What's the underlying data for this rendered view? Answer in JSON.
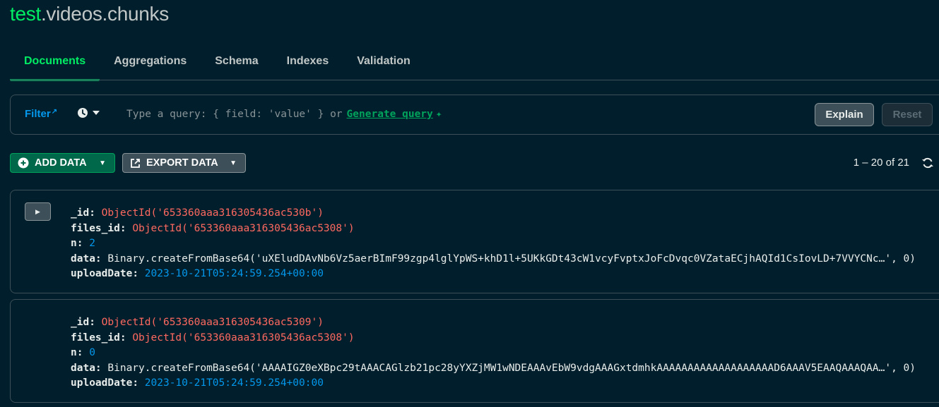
{
  "collection": {
    "db": "test",
    "rest": ".videos.chunks"
  },
  "tabs": [
    "Documents",
    "Aggregations",
    "Schema",
    "Indexes",
    "Validation"
  ],
  "query_bar": {
    "filter_label": "Filter",
    "placeholder": "Type a query: { field: 'value' } or",
    "generate_label": "Generate query",
    "explain_label": "Explain",
    "reset_label": "Reset"
  },
  "toolbar": {
    "add_label": "ADD DATA",
    "export_label": "EXPORT DATA",
    "pagination": "1 – 20 of 21"
  },
  "documents": [
    {
      "fields": [
        {
          "key": "_id",
          "value": "ObjectId('653360aaa316305436ac530b')",
          "kind": "oid"
        },
        {
          "key": "files_id",
          "value": "ObjectId('653360aaa316305436ac5308')",
          "kind": "oid"
        },
        {
          "key": "n",
          "value": "2",
          "kind": "num"
        },
        {
          "key": "data",
          "value": "Binary.createFromBase64('uXEludDAvNb6Vz5aerBImF99zgp4lglYpWS+khD1l+5UKkGDt43cW1vcyFvptxJoFcDvqc0VZataECjhAQId1CsIovLD+7VVYCNc…', 0)",
          "kind": "bin"
        },
        {
          "key": "uploadDate",
          "value": "2023-10-21T05:24:59.254+00:00",
          "kind": "date"
        }
      ]
    },
    {
      "fields": [
        {
          "key": "_id",
          "value": "ObjectId('653360aaa316305436ac5309')",
          "kind": "oid"
        },
        {
          "key": "files_id",
          "value": "ObjectId('653360aaa316305436ac5308')",
          "kind": "oid"
        },
        {
          "key": "n",
          "value": "0",
          "kind": "num"
        },
        {
          "key": "data",
          "value": "Binary.createFromBase64('AAAAIGZ0eXBpc29tAAACAGlzb21pc28yYXZjMW1wNDEAAAvEbW9vdgAAAGxtdmhkAAAAAAAAAAAAAAAAAAAD6AAAV5EAAQAAAQAA…', 0)",
          "kind": "bin"
        },
        {
          "key": "uploadDate",
          "value": "2023-10-21T05:24:59.254+00:00",
          "kind": "date"
        }
      ]
    }
  ],
  "colors": {
    "background": "#001e2b",
    "accent_green": "#00ed64",
    "link_blue": "#0498ec",
    "objectid_red": "#ff6960"
  },
  "icons": [
    "external-link-icon",
    "clock-icon",
    "sparkle-icon",
    "plus-circle-icon",
    "export-icon",
    "refresh-icon",
    "caret-right-icon"
  ]
}
